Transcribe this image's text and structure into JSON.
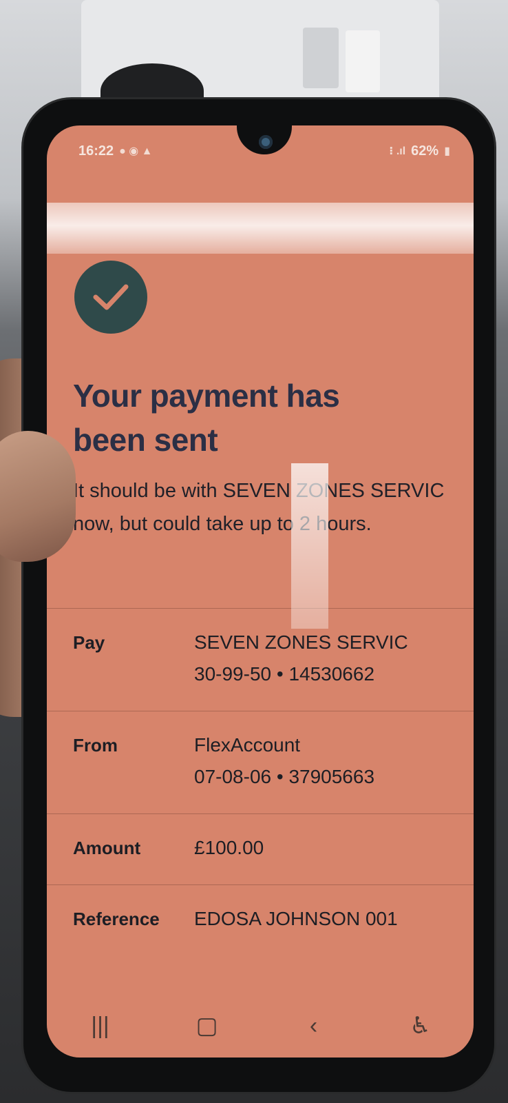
{
  "status_bar": {
    "time": "16:22",
    "battery": "62%"
  },
  "confirmation": {
    "title_line1": "Your payment has",
    "title_line2": "been sent",
    "message": "It should be with SEVEN ZONES SERVIC now, but could take up to 2 hours."
  },
  "details": [
    {
      "label": "Pay",
      "line1": "SEVEN ZONES SERVIC",
      "line2": "30-99-50 • 14530662"
    },
    {
      "label": "From",
      "line1": "FlexAccount",
      "line2": "07-08-06 • 37905663"
    },
    {
      "label": "Amount",
      "line1": "£100.00",
      "line2": ""
    },
    {
      "label": "Reference",
      "line1": "EDOSA JOHNSON 001",
      "line2": ""
    }
  ],
  "nav_bar": {
    "recents_icon": "recents-icon",
    "home_icon": "home-icon",
    "back_icon": "back-icon",
    "accessibility_icon": "accessibility-icon"
  },
  "colors": {
    "screen_background": "#d7846b",
    "check_circle": "#2f4a4a",
    "title_text": "#2b2f45"
  }
}
